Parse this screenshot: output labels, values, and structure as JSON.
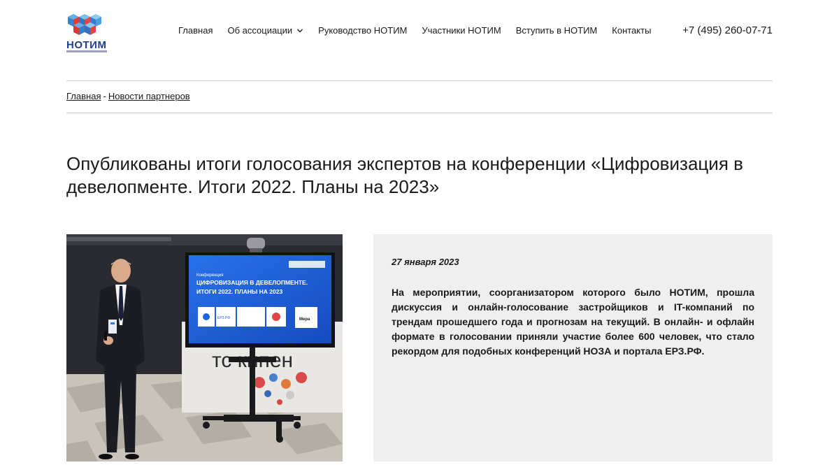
{
  "header": {
    "logo_text": "НОТИМ",
    "nav": [
      {
        "label": "Главная"
      },
      {
        "label": "Об ассоциации",
        "has_dropdown": true
      },
      {
        "label": "Руководство НОТИМ"
      },
      {
        "label": "Участники НОТИМ"
      },
      {
        "label": "Вступить в НОТИМ"
      },
      {
        "label": "Контакты"
      }
    ],
    "phone": "+7 (495) 260-07-71"
  },
  "breadcrumb": {
    "home": "Главная",
    "separator": "-",
    "current": "Новости партнеров"
  },
  "article": {
    "title": "Опубликованы итоги голосования экспертов на конференции «Цифровизация в девелопменте. Итоги 2022. Планы на 2023»",
    "date": "27 января 2023",
    "text": "На мероприятии, соорганизатором которого было НОТИМ, прошла дискуссия и онлайн-голосование застройщиков и IT-компаний по трендам прошедшего года и прогнозам на текущий. В онлайн- и офлайн формате в голосовании приняли участие более 600 человек, что стало рекордом для подобных конференций НОЗА и портала ЕРЗ.РФ."
  },
  "photo": {
    "screen_label": "Конференция",
    "screen_title_1": "ЦИФРОВИЗАЦИЯ В ДЕВЕЛОПМЕНТЕ.",
    "screen_title_2": "ИТОГИ 2022. ПЛАНЫ НА 2023",
    "sponsor_1": "ЕРЗ.РФ",
    "sponsor_2": "Мера",
    "wall_text": "тс   кипен"
  },
  "colors": {
    "accent_blue": "#1f3f8f",
    "card_bg": "#efefef",
    "divider": "#c9c9c9",
    "screen_blue": "#1e63e0"
  },
  "icons": {
    "dropdown": "chevron-down-icon",
    "logo": "cubes-logo-icon"
  }
}
